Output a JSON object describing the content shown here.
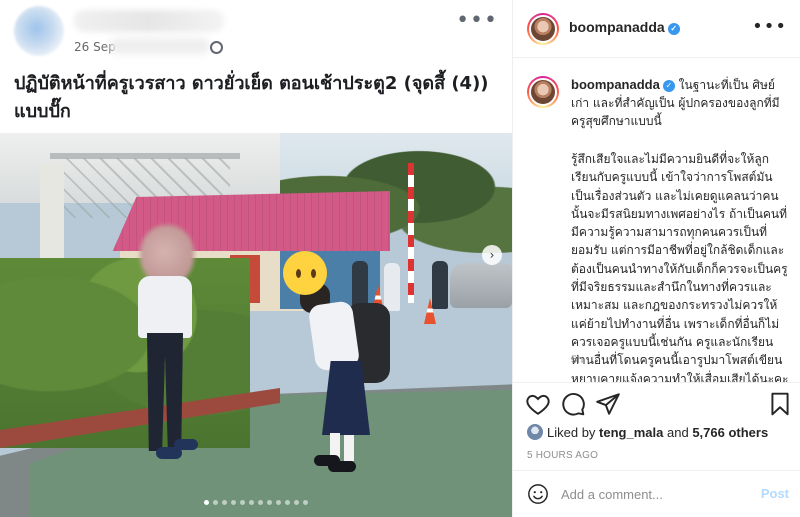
{
  "facebook_post": {
    "date": "26 Sep",
    "caption_line1": "ปฏิบัติหน้าที่ครูเวรสาว ดาวยั่วเย็ด ตอนเช้าประตู2 (จุดสี้ (4))",
    "caption_line2": "แบบปั๊ก",
    "carousel_dots_count": 12,
    "carousel_active_dot": 0
  },
  "instagram": {
    "header": {
      "username": "boompanadda"
    },
    "comment": {
      "username": "boompanadda",
      "lead": "ในฐานะที่เป็น ศิษย์เก่า และที่สำคัญเป็น ผู้ปกครองของลูกที่มีครูสุขศึกษาแบบนี้",
      "body": "รู้สึกเสียใจและไม่มีความยินดีที่จะให้ลูกเรียนกับครูแบบนี้ เข้าใจว่าการโพสต์มันเป็นเรื่องส่วนตัว และไม่เคยดูแคลนว่าคนนั้นจะมีรสนิยมทางเพศอย่างไร ถ้าเป็นคนที่มีความรู้ความสามารถทุกคนควรเป็นที่ยอมรับ แต่การมีอาชีพที่อยู่ใกล้ชิดเด็กและต้องเป็นคนนำทางให้กับเด็กก็ควรจะเป็นครูที่มีจริยธรรมและสำนึกในทางที่ควรและเหมาะสม และกฎของกระทรวงไม่ควรให้แค่ย้ายไปทำงานที่อื่น เพราะเด็กที่อื่นก็ไม่ควรเจอครูแบบนี้เช่นกัน ครูและนักเรียนท่านอื่นที่โดนครูคนนี้เอารูปมาโพสต์เขียนหยาบคายแจ้งความทำให้เสื่อมเสียได้นะคะ",
      "time": "5h"
    },
    "likes": {
      "prefix": "Liked by",
      "user": "teng_mala",
      "connector": "and",
      "others": "5,766 others"
    },
    "timestamp": "5 HOURS AGO",
    "add_comment": {
      "placeholder": "Add a comment...",
      "post_label": "Post"
    },
    "colors": {
      "link_blue": "#3897f0",
      "post_disabled": "#b3dbff",
      "muted": "#8e8e8e"
    }
  }
}
